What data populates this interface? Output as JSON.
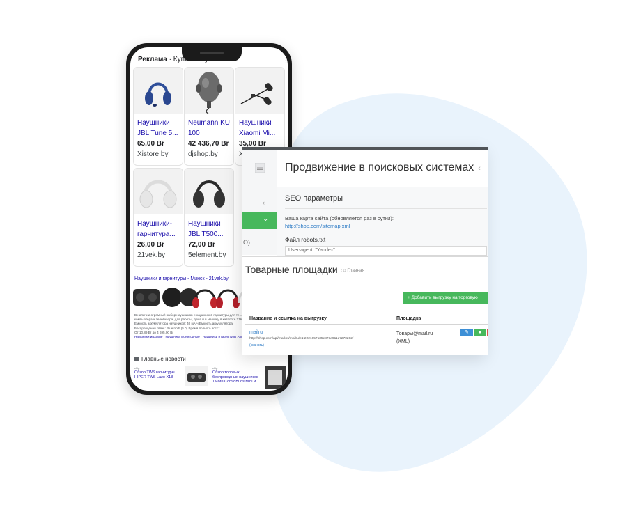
{
  "colors": {
    "blob": "#e9f3fc",
    "accent_green": "#47b85c",
    "link_blue": "#2d7bc5",
    "serp_link": "#1a0dab",
    "topbar": "#505458"
  },
  "phone": {
    "header_ad": "Реклама",
    "header_sep": " · ",
    "header_query": "Купить наушники",
    "more_icon": "more-vert-icon",
    "products": [
      {
        "title_l1": "Наушники",
        "title_l2": "JBL Tune 5...",
        "price": "65,00 Br",
        "store": "Xistore.by",
        "image": "blue-headphones"
      },
      {
        "title_l1": "Neumann KU",
        "title_l2": "100",
        "price": "42 436,70 Br",
        "store": "djshop.by",
        "image": "dummy-head-microphone"
      },
      {
        "title_l1": "Наушники",
        "title_l2": "Xiaomi Mi...",
        "price": "35,00 Br",
        "store": "Xi",
        "image": "black-earbuds"
      },
      {
        "title_l1": "Наушники-",
        "title_l2": "гарнитура...",
        "price": "26,00 Br",
        "store": "21vek.by",
        "image": "white-headphones"
      },
      {
        "title_l1": "Наушники",
        "title_l2": "JBL T500...",
        "price": "72,00 Br",
        "store": "5element.by",
        "image": "black-headphones"
      }
    ],
    "organic_title": "Наушники и гарнитуры - Минск - 21vek.by",
    "snippet_lines": [
      "В наличии огромный выбор наушников и наушников-гарнитуры для те...",
      "компьютера и телевизора, для работы, дома и в машину в каталоге 21в...",
      "Емкость аккумулятора наушников: 40 мА·ч     Емкость аккумулятора",
      "Беспроводная связь: Bluetooth (5.0)           Время полного восст",
      "От 10,89 Br до 4 695,00 Br"
    ],
    "snippet_links": "Наушники игровые · Наушники мониторные · Наушники и гарнитуры Apple",
    "news_title": "Главные новости",
    "news": [
      {
        "source": "сhip",
        "title_l1": "Обзор TWS гарнитуры",
        "title_l2": "HIPER TWS Lazo X18"
      },
      {
        "source": "сhip",
        "title_l1": "Обзор топовых",
        "title_l2": "беспроводных наушников",
        "title_l3": "1More ComfoBuds Mini и..."
      }
    ]
  },
  "panel": {
    "seo_title": "Продвижение в поисковых системах",
    "seo_title_sep": "‹",
    "seo_params": "SEO параметры",
    "sitemap_label": "Ваша карта сайта (обновляется раз в сутки):",
    "sitemap_url": "http://shop.com/sitemap.xml",
    "robots_label": "Файл robots.txt",
    "robots_content": "User-agent: \"Yandex\"",
    "sidebar_text": "O)",
    "market_title": "Товарные площадки",
    "market_crumb_sep": "‹",
    "market_crumb": "Главная",
    "add_button": "+ Добавить выгрузку на торговую",
    "table": {
      "col_name": "Название и ссылка на выгрузку",
      "col_platform": "Площадка",
      "rows": [
        {
          "name": "mailru",
          "url": "http://shop.com/api/market/mailru/e1f2221857135e873a911d7270282f",
          "download": "(скачать)",
          "platform_l1": "Товары@mail.ru",
          "platform_l2": "(XML)"
        }
      ]
    }
  }
}
